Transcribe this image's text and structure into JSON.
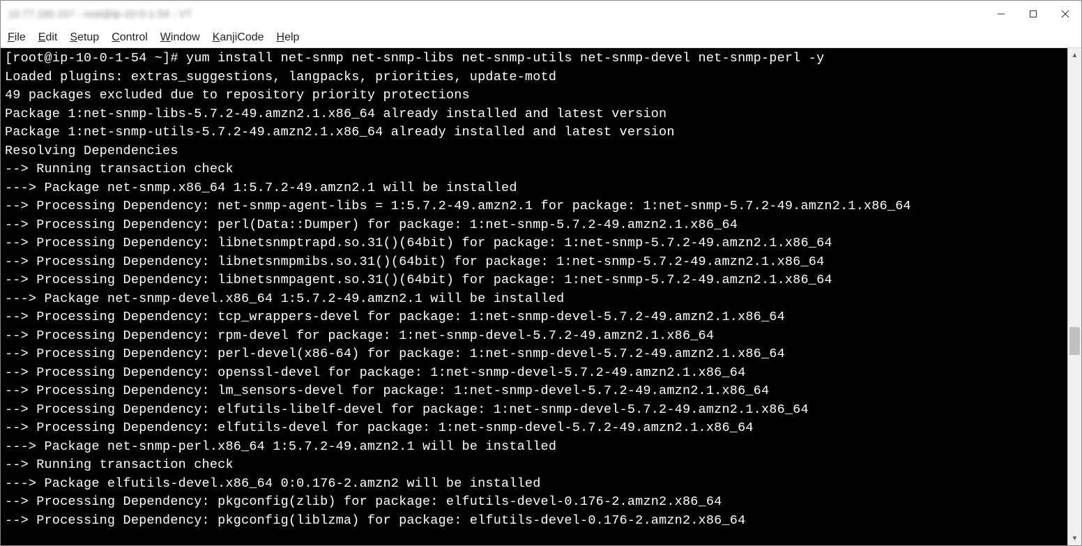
{
  "titlebar": {
    "title": "10.77.160.157 - root@ip-10-0-1-54 - VT"
  },
  "menu": {
    "file": "File",
    "edit": "Edit",
    "setup": "Setup",
    "control": "Control",
    "window": "Window",
    "kanjicode": "KanjiCode",
    "help": "Help"
  },
  "terminal": {
    "lines": [
      "[root@ip-10-0-1-54 ~]# yum install net-snmp net-snmp-libs net-snmp-utils net-snmp-devel net-snmp-perl -y",
      "Loaded plugins: extras_suggestions, langpacks, priorities, update-motd",
      "49 packages excluded due to repository priority protections",
      "Package 1:net-snmp-libs-5.7.2-49.amzn2.1.x86_64 already installed and latest version",
      "Package 1:net-snmp-utils-5.7.2-49.amzn2.1.x86_64 already installed and latest version",
      "Resolving Dependencies",
      "--> Running transaction check",
      "---> Package net-snmp.x86_64 1:5.7.2-49.amzn2.1 will be installed",
      "--> Processing Dependency: net-snmp-agent-libs = 1:5.7.2-49.amzn2.1 for package: 1:net-snmp-5.7.2-49.amzn2.1.x86_64",
      "--> Processing Dependency: perl(Data::Dumper) for package: 1:net-snmp-5.7.2-49.amzn2.1.x86_64",
      "--> Processing Dependency: libnetsnmptrapd.so.31()(64bit) for package: 1:net-snmp-5.7.2-49.amzn2.1.x86_64",
      "--> Processing Dependency: libnetsnmpmibs.so.31()(64bit) for package: 1:net-snmp-5.7.2-49.amzn2.1.x86_64",
      "--> Processing Dependency: libnetsnmpagent.so.31()(64bit) for package: 1:net-snmp-5.7.2-49.amzn2.1.x86_64",
      "---> Package net-snmp-devel.x86_64 1:5.7.2-49.amzn2.1 will be installed",
      "--> Processing Dependency: tcp_wrappers-devel for package: 1:net-snmp-devel-5.7.2-49.amzn2.1.x86_64",
      "--> Processing Dependency: rpm-devel for package: 1:net-snmp-devel-5.7.2-49.amzn2.1.x86_64",
      "--> Processing Dependency: perl-devel(x86-64) for package: 1:net-snmp-devel-5.7.2-49.amzn2.1.x86_64",
      "--> Processing Dependency: openssl-devel for package: 1:net-snmp-devel-5.7.2-49.amzn2.1.x86_64",
      "--> Processing Dependency: lm_sensors-devel for package: 1:net-snmp-devel-5.7.2-49.amzn2.1.x86_64",
      "--> Processing Dependency: elfutils-libelf-devel for package: 1:net-snmp-devel-5.7.2-49.amzn2.1.x86_64",
      "--> Processing Dependency: elfutils-devel for package: 1:net-snmp-devel-5.7.2-49.amzn2.1.x86_64",
      "---> Package net-snmp-perl.x86_64 1:5.7.2-49.amzn2.1 will be installed",
      "--> Running transaction check",
      "---> Package elfutils-devel.x86_64 0:0.176-2.amzn2 will be installed",
      "--> Processing Dependency: pkgconfig(zlib) for package: elfutils-devel-0.176-2.amzn2.x86_64",
      "--> Processing Dependency: pkgconfig(liblzma) for package: elfutils-devel-0.176-2.amzn2.x86_64"
    ]
  }
}
